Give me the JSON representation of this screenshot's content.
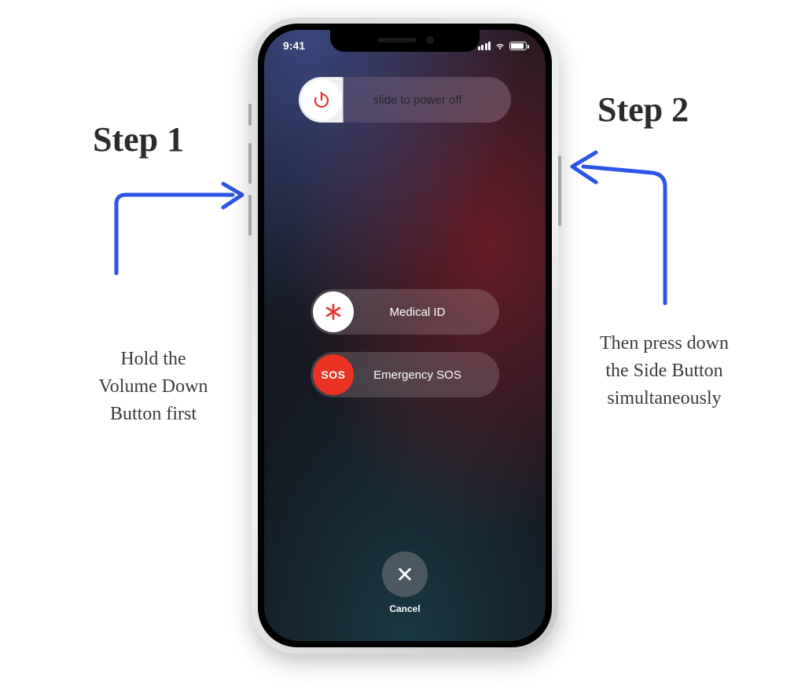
{
  "status": {
    "time": "9:41"
  },
  "sliders": {
    "power": {
      "label": "slide to power off"
    },
    "medical": {
      "label": "Medical ID"
    },
    "sos": {
      "label": "Emergency SOS",
      "knob_text": "SOS"
    }
  },
  "cancel": {
    "label": "Cancel"
  },
  "step1": {
    "title": "Step 1",
    "desc": "Hold the\nVolume Down\nButton first"
  },
  "step2": {
    "title": "Step 2",
    "desc": "Then press down\nthe Side Button\nsimultaneously"
  }
}
